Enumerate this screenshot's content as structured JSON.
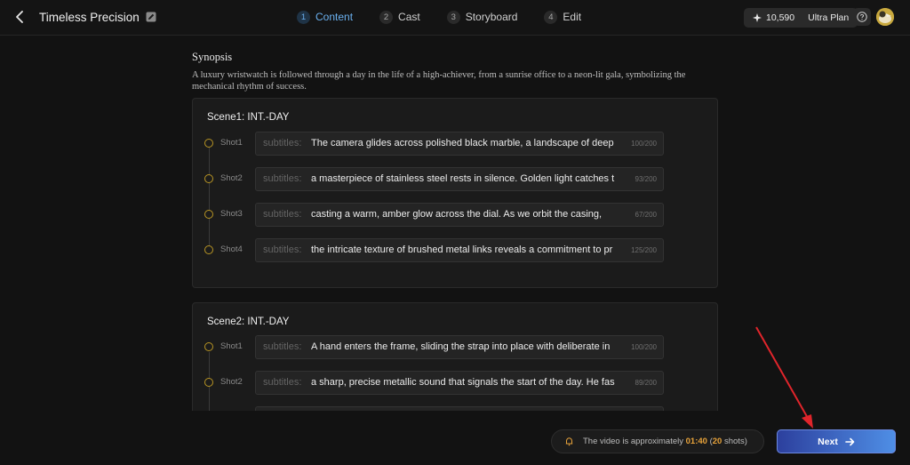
{
  "header": {
    "title": "Timeless Precision",
    "steps": [
      {
        "num": "1",
        "label": "Content"
      },
      {
        "num": "2",
        "label": "Cast"
      },
      {
        "num": "3",
        "label": "Storyboard"
      },
      {
        "num": "4",
        "label": "Edit"
      }
    ],
    "active_step": "Content",
    "credits": "10,590",
    "plan": "Ultra Plan",
    "accent": "#6ab0ef"
  },
  "synopsis": {
    "heading": "Synopsis",
    "text": "A luxury wristwatch is followed through a day in the life of a high-achiever, from a sunrise office to a neon-lit gala, symbolizing the mechanical rhythm of success."
  },
  "scenes": [
    {
      "title": "Scene1: INT.-DAY",
      "shots": [
        {
          "label": "Shot1",
          "key": "subtitles:",
          "text": "The camera glides across polished black marble, a landscape of deep",
          "count": "100/200"
        },
        {
          "label": "Shot2",
          "key": "subtitles:",
          "text": "a masterpiece of stainless steel rests in silence. Golden light catches t",
          "count": "93/200"
        },
        {
          "label": "Shot3",
          "key": "subtitles:",
          "text": "casting a warm, amber glow across the dial. As we orbit the casing,",
          "count": "67/200"
        },
        {
          "label": "Shot4",
          "key": "subtitles:",
          "text": "the intricate texture of brushed metal links reveals a commitment to pr",
          "count": "125/200"
        }
      ]
    },
    {
      "title": "Scene2: INT.-DAY",
      "shots": [
        {
          "label": "Shot1",
          "key": "subtitles:",
          "text": "A hand enters the frame, sliding the strap into place with deliberate in",
          "count": "100/200"
        },
        {
          "label": "Shot2",
          "key": "subtitles:",
          "text": "a sharp, precise metallic sound that signals the start of the day. He fas",
          "count": "89/200"
        }
      ]
    }
  ],
  "footer": {
    "info_prefix": "The video is approximately",
    "duration": "01:40",
    "shots_open": "(",
    "shots_count": "20",
    "shots_suffix": "shots)",
    "next_label": "Next",
    "warning_color": "#e8a33a",
    "button_color": "#4f8fe6"
  },
  "annotation": {
    "arrow_color": "#e0252b"
  }
}
